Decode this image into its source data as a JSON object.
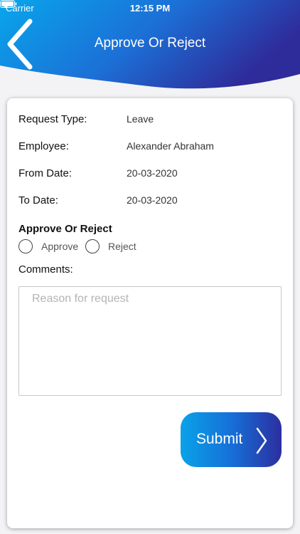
{
  "status_bar": {
    "carrier": "Carrier",
    "time": "12:15 PM",
    "wifi_icon": "wifi-icon",
    "battery_icon": "battery-icon"
  },
  "header": {
    "title": "Approve Or Reject",
    "back_icon": "chevron-left-icon",
    "gradient_colors": [
      "#08a6ec",
      "#2a3cb0",
      "#2e2c9a"
    ]
  },
  "form": {
    "fields": [
      {
        "label": "Request Type:",
        "value": "Leave"
      },
      {
        "label": "Employee:",
        "value": "Alexander Abraham"
      },
      {
        "label": "From Date:",
        "value": "20-03-2020"
      },
      {
        "label": "To Date:",
        "value": "20-03-2020"
      }
    ],
    "decision_title": "Approve Or Reject",
    "options": [
      {
        "label": "Approve",
        "selected": false
      },
      {
        "label": "Reject",
        "selected": false
      }
    ],
    "comments_label": "Comments:",
    "comments_value": "",
    "comments_placeholder": "Reason for request"
  },
  "submit": {
    "label": "Submit",
    "icon": "chevron-right-icon"
  }
}
